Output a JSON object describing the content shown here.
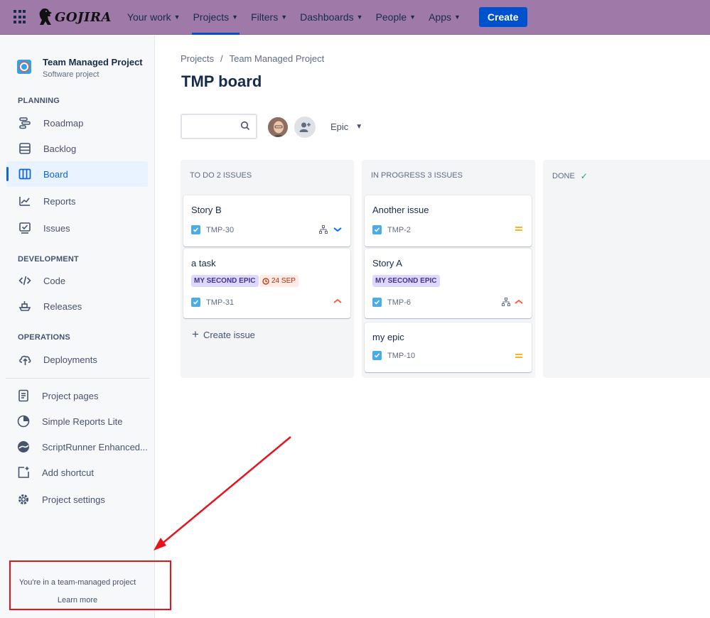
{
  "topnav": {
    "logo_text": "GOJIRA",
    "items": [
      {
        "label": "Your work"
      },
      {
        "label": "Projects"
      },
      {
        "label": "Filters"
      },
      {
        "label": "Dashboards"
      },
      {
        "label": "People"
      },
      {
        "label": "Apps"
      }
    ],
    "create_label": "Create",
    "accent": "#9f7aa9"
  },
  "sidebar": {
    "project_name": "Team Managed Project",
    "project_type": "Software project",
    "planning_heading": "PLANNING",
    "planning": [
      {
        "label": "Roadmap",
        "icon": "roadmap-icon"
      },
      {
        "label": "Backlog",
        "icon": "backlog-icon"
      },
      {
        "label": "Board",
        "icon": "board-icon"
      },
      {
        "label": "Reports",
        "icon": "reports-icon"
      },
      {
        "label": "Issues",
        "icon": "issues-icon"
      }
    ],
    "development_heading": "DEVELOPMENT",
    "development": [
      {
        "label": "Code",
        "icon": "code-icon"
      },
      {
        "label": "Releases",
        "icon": "releases-icon"
      }
    ],
    "operations_heading": "OPERATIONS",
    "operations": [
      {
        "label": "Deployments",
        "icon": "deployments-icon"
      }
    ],
    "extras": [
      {
        "label": "Project pages",
        "icon": "pages-icon"
      },
      {
        "label": "Simple Reports Lite",
        "icon": "pie-chart-icon"
      },
      {
        "label": "ScriptRunner Enhanced...",
        "icon": "scriptrunner-icon"
      },
      {
        "label": "Add shortcut",
        "icon": "add-shortcut-icon"
      },
      {
        "label": "Project settings",
        "icon": "gear-icon"
      }
    ],
    "footer_text": "You're in a team-managed project",
    "learn_more": "Learn more"
  },
  "breadcrumb": {
    "root": "Projects",
    "separator": "/",
    "current": "Team Managed Project"
  },
  "page_title": "TMP board",
  "filter": {
    "epic_label": "Epic"
  },
  "board": {
    "columns": [
      {
        "title": "TO DO 2 ISSUES",
        "cards": [
          {
            "title": "Story B",
            "key": "TMP-30"
          },
          {
            "title": "a task",
            "epic": "MY SECOND EPIC",
            "due": "24 SEP",
            "key": "TMP-31"
          }
        ],
        "create_label": "Create issue"
      },
      {
        "title": "IN PROGRESS 3 ISSUES",
        "cards": [
          {
            "title": "Another issue",
            "key": "TMP-2"
          },
          {
            "title": "Story A",
            "epic": "MY SECOND EPIC",
            "key": "TMP-6"
          },
          {
            "title": "my epic",
            "key": "TMP-10"
          }
        ]
      },
      {
        "title": "DONE",
        "cards": []
      }
    ]
  }
}
